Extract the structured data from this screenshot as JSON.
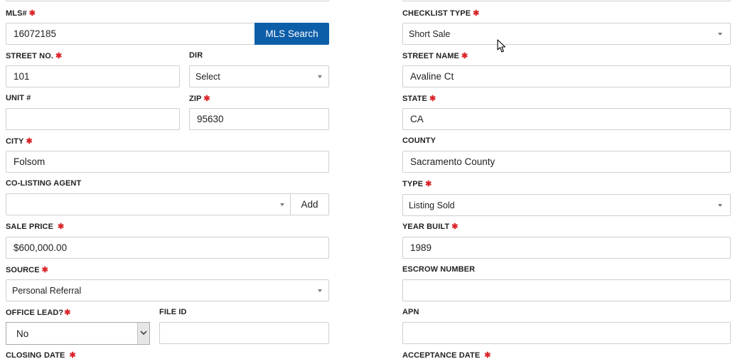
{
  "required_mark": "✱",
  "left": {
    "mls_label": "MLS#",
    "mls_value": "16072185",
    "mls_search_button": "MLS Search",
    "street_no_label": "STREET NO.",
    "street_no_value": "101",
    "dir_label": "DIR",
    "dir_value": "Select",
    "unit_label": "UNIT #",
    "unit_value": "",
    "zip_label": "ZIP",
    "zip_value": "95630",
    "city_label": "CITY",
    "city_value": "Folsom",
    "co_agent_label": "CO-LISTING AGENT",
    "co_agent_value": "",
    "add_button": "Add",
    "sale_price_label": "SALE PRICE",
    "sale_price_value": "$600,000.00",
    "source_label": "SOURCE",
    "source_value": "Personal Referral",
    "office_lead_label": "OFFICE LEAD?",
    "office_lead_value": "No",
    "file_id_label": "FILE ID",
    "file_id_value": "",
    "closing_date_label": "CLOSING DATE"
  },
  "right": {
    "checklist_type_label": "CHECKLIST TYPE",
    "checklist_type_value": "Short Sale",
    "street_name_label": "STREET NAME",
    "street_name_value": "Avaline Ct",
    "state_label": "STATE",
    "state_value": "CA",
    "county_label": "COUNTY",
    "county_value": "Sacramento County",
    "type_label": "TYPE",
    "type_value": "Listing Sold",
    "year_built_label": "YEAR BUILT",
    "year_built_value": "1989",
    "escrow_label": "ESCROW NUMBER",
    "escrow_value": "",
    "apn_label": "APN",
    "apn_value": "",
    "acceptance_date_label": "ACCEPTANCE DATE"
  },
  "icons": {
    "caret": "chevron-down-icon",
    "cursor": "mouse-pointer-icon",
    "required": "asterisk-icon"
  }
}
